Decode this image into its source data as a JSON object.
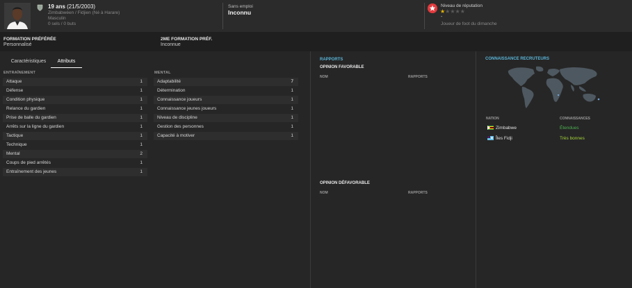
{
  "player": {
    "age": "19 ans",
    "birth": "(21/5/2003)",
    "nationality": "Zimbabwéen / Fidjien (Né à Harare)",
    "gender": "Masculin",
    "stats": "0 sels / 0 buts"
  },
  "club": {
    "caption": "Sans emploi",
    "name": "Inconnu"
  },
  "reputation": {
    "caption": "Niveau de réputation",
    "value_stars": 0.5,
    "max_stars": 5,
    "dash": "-",
    "level": "Joueur de foot du dimanche"
  },
  "formation": {
    "preferred_label": "FORMATION PRÉFÉRÉE",
    "preferred_value": "Personnalisé",
    "second_label": "2ME FORMATION PRÉF.",
    "second_value": "Inconnue"
  },
  "tabs": [
    {
      "label": "Caractéristiques",
      "active": false
    },
    {
      "label": "Attributs",
      "active": true
    }
  ],
  "training": {
    "label": "ENTRAÎNEMENT",
    "rows": [
      {
        "name": "Attaque",
        "value": "1"
      },
      {
        "name": "Défense",
        "value": "1"
      },
      {
        "name": "Condition physique",
        "value": "1"
      },
      {
        "name": "Relance du gardien",
        "value": "1"
      },
      {
        "name": "Prise de balle du gardien",
        "value": "1"
      },
      {
        "name": "Arrêts sur la ligne du gardien",
        "value": "1"
      },
      {
        "name": "Tactique",
        "value": "1"
      },
      {
        "name": "Technique",
        "value": "1"
      },
      {
        "name": "Mental",
        "value": "2"
      },
      {
        "name": "Coups de pied arrêtés",
        "value": "1"
      },
      {
        "name": "Entraînement des jeunes",
        "value": "1"
      }
    ]
  },
  "mental": {
    "label": "MENTAL",
    "rows": [
      {
        "name": "Adaptabilité",
        "value": "7"
      },
      {
        "name": "Détermination",
        "value": "1"
      },
      {
        "name": "Connaissance joueurs",
        "value": "1"
      },
      {
        "name": "Connaissance jeunes joueurs",
        "value": "1"
      },
      {
        "name": "Niveau de discipline",
        "value": "1"
      },
      {
        "name": "Gestion des personnes",
        "value": "1"
      },
      {
        "name": "Capacité à motiver",
        "value": "1"
      }
    ]
  },
  "reports": {
    "title": "RAPPORTS",
    "favorable": "OPINION FAVORABLE",
    "unfavorable": "OPINION DÉFAVORABLE",
    "col_name": "NOM",
    "col_reports": "RAPPORTS"
  },
  "recruiters": {
    "title": "CONNAISSANCE RECRUTEURS",
    "col_nation": "NATION",
    "col_knowledge": "CONNAISSANCES",
    "rows": [
      {
        "nation": "Zimbabwe",
        "knowledge": "Étendues",
        "color": "#4caf50"
      },
      {
        "nation": "Îles Fidji",
        "knowledge": "Très bonnes",
        "color": "#a4d23a"
      }
    ]
  },
  "colors": {
    "accent": "#5ab4d6",
    "reputation_badge": "#e03a3e",
    "star": "#e6b800"
  }
}
